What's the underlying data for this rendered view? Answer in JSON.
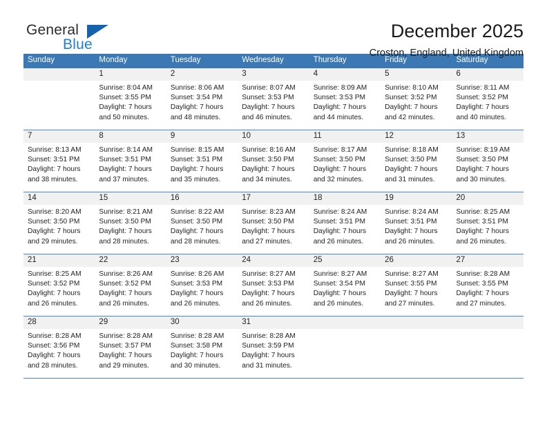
{
  "brand": {
    "word1": "General",
    "word2": "Blue",
    "icon": "triangle-logo"
  },
  "header": {
    "month_title": "December 2025",
    "location": "Croston, England, United Kingdom"
  },
  "colors": {
    "header_bar": "#3b78b4",
    "brand_blue": "#1b7fd4",
    "logo_triangle": "#1463ad",
    "daynum_band": "#f1f1f1",
    "row_divider": "#4a87c2",
    "text": "#222222"
  },
  "calendar": {
    "weekday_headers": [
      "Sunday",
      "Monday",
      "Tuesday",
      "Wednesday",
      "Thursday",
      "Friday",
      "Saturday"
    ],
    "weeks": [
      [
        {
          "day": "",
          "text": ""
        },
        {
          "day": "1",
          "text": "Sunrise: 8:04 AM\nSunset: 3:55 PM\nDaylight: 7 hours\nand 50 minutes."
        },
        {
          "day": "2",
          "text": "Sunrise: 8:06 AM\nSunset: 3:54 PM\nDaylight: 7 hours\nand 48 minutes."
        },
        {
          "day": "3",
          "text": "Sunrise: 8:07 AM\nSunset: 3:53 PM\nDaylight: 7 hours\nand 46 minutes."
        },
        {
          "day": "4",
          "text": "Sunrise: 8:09 AM\nSunset: 3:53 PM\nDaylight: 7 hours\nand 44 minutes."
        },
        {
          "day": "5",
          "text": "Sunrise: 8:10 AM\nSunset: 3:52 PM\nDaylight: 7 hours\nand 42 minutes."
        },
        {
          "day": "6",
          "text": "Sunrise: 8:11 AM\nSunset: 3:52 PM\nDaylight: 7 hours\nand 40 minutes."
        }
      ],
      [
        {
          "day": "7",
          "text": "Sunrise: 8:13 AM\nSunset: 3:51 PM\nDaylight: 7 hours\nand 38 minutes."
        },
        {
          "day": "8",
          "text": "Sunrise: 8:14 AM\nSunset: 3:51 PM\nDaylight: 7 hours\nand 37 minutes."
        },
        {
          "day": "9",
          "text": "Sunrise: 8:15 AM\nSunset: 3:51 PM\nDaylight: 7 hours\nand 35 minutes."
        },
        {
          "day": "10",
          "text": "Sunrise: 8:16 AM\nSunset: 3:50 PM\nDaylight: 7 hours\nand 34 minutes."
        },
        {
          "day": "11",
          "text": "Sunrise: 8:17 AM\nSunset: 3:50 PM\nDaylight: 7 hours\nand 32 minutes."
        },
        {
          "day": "12",
          "text": "Sunrise: 8:18 AM\nSunset: 3:50 PM\nDaylight: 7 hours\nand 31 minutes."
        },
        {
          "day": "13",
          "text": "Sunrise: 8:19 AM\nSunset: 3:50 PM\nDaylight: 7 hours\nand 30 minutes."
        }
      ],
      [
        {
          "day": "14",
          "text": "Sunrise: 8:20 AM\nSunset: 3:50 PM\nDaylight: 7 hours\nand 29 minutes."
        },
        {
          "day": "15",
          "text": "Sunrise: 8:21 AM\nSunset: 3:50 PM\nDaylight: 7 hours\nand 28 minutes."
        },
        {
          "day": "16",
          "text": "Sunrise: 8:22 AM\nSunset: 3:50 PM\nDaylight: 7 hours\nand 28 minutes."
        },
        {
          "day": "17",
          "text": "Sunrise: 8:23 AM\nSunset: 3:50 PM\nDaylight: 7 hours\nand 27 minutes."
        },
        {
          "day": "18",
          "text": "Sunrise: 8:24 AM\nSunset: 3:51 PM\nDaylight: 7 hours\nand 26 minutes."
        },
        {
          "day": "19",
          "text": "Sunrise: 8:24 AM\nSunset: 3:51 PM\nDaylight: 7 hours\nand 26 minutes."
        },
        {
          "day": "20",
          "text": "Sunrise: 8:25 AM\nSunset: 3:51 PM\nDaylight: 7 hours\nand 26 minutes."
        }
      ],
      [
        {
          "day": "21",
          "text": "Sunrise: 8:25 AM\nSunset: 3:52 PM\nDaylight: 7 hours\nand 26 minutes."
        },
        {
          "day": "22",
          "text": "Sunrise: 8:26 AM\nSunset: 3:52 PM\nDaylight: 7 hours\nand 26 minutes."
        },
        {
          "day": "23",
          "text": "Sunrise: 8:26 AM\nSunset: 3:53 PM\nDaylight: 7 hours\nand 26 minutes."
        },
        {
          "day": "24",
          "text": "Sunrise: 8:27 AM\nSunset: 3:53 PM\nDaylight: 7 hours\nand 26 minutes."
        },
        {
          "day": "25",
          "text": "Sunrise: 8:27 AM\nSunset: 3:54 PM\nDaylight: 7 hours\nand 26 minutes."
        },
        {
          "day": "26",
          "text": "Sunrise: 8:27 AM\nSunset: 3:55 PM\nDaylight: 7 hours\nand 27 minutes."
        },
        {
          "day": "27",
          "text": "Sunrise: 8:28 AM\nSunset: 3:55 PM\nDaylight: 7 hours\nand 27 minutes."
        }
      ],
      [
        {
          "day": "28",
          "text": "Sunrise: 8:28 AM\nSunset: 3:56 PM\nDaylight: 7 hours\nand 28 minutes."
        },
        {
          "day": "29",
          "text": "Sunrise: 8:28 AM\nSunset: 3:57 PM\nDaylight: 7 hours\nand 29 minutes."
        },
        {
          "day": "30",
          "text": "Sunrise: 8:28 AM\nSunset: 3:58 PM\nDaylight: 7 hours\nand 30 minutes."
        },
        {
          "day": "31",
          "text": "Sunrise: 8:28 AM\nSunset: 3:59 PM\nDaylight: 7 hours\nand 31 minutes."
        },
        {
          "day": "",
          "text": ""
        },
        {
          "day": "",
          "text": ""
        },
        {
          "day": "",
          "text": ""
        }
      ]
    ]
  }
}
